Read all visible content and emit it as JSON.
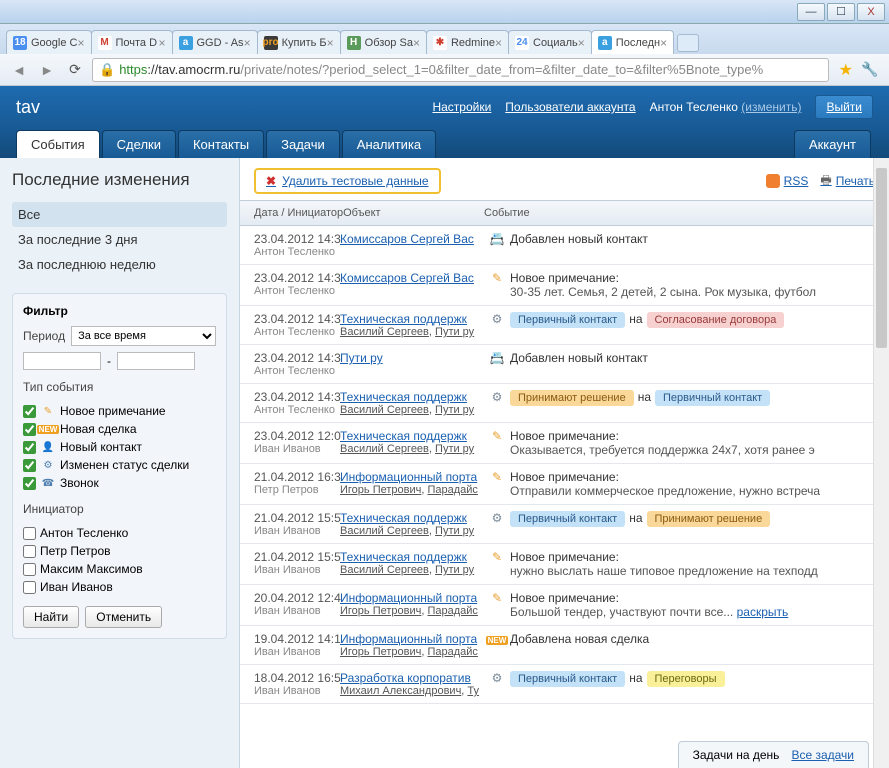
{
  "window": {
    "min": "—",
    "max": "☐",
    "close": "X"
  },
  "browserTabs": [
    {
      "favicon": "18",
      "faviconBg": "#4a8ef0",
      "faviconColor": "#fff",
      "label": "Google C"
    },
    {
      "favicon": "M",
      "faviconBg": "#fff",
      "faviconColor": "#d04030",
      "label": "Почта D"
    },
    {
      "favicon": "a",
      "faviconBg": "#3aa0e0",
      "faviconColor": "#fff",
      "label": "GGD - As"
    },
    {
      "favicon": "pro",
      "faviconBg": "#3a3a3a",
      "faviconColor": "#f0a020",
      "label": "Купить Б"
    },
    {
      "favicon": "H",
      "faviconBg": "#5a9a5a",
      "faviconColor": "#fff",
      "label": "Обзор Sa"
    },
    {
      "favicon": "✱",
      "faviconBg": "#fff",
      "faviconColor": "#d04030",
      "label": "Redmine"
    },
    {
      "favicon": "24",
      "faviconBg": "#fff",
      "faviconColor": "#4a8ef0",
      "label": "Социаль"
    },
    {
      "favicon": "a",
      "faviconBg": "#3aa0e0",
      "faviconColor": "#fff",
      "label": "Последн",
      "active": true
    }
  ],
  "url": {
    "https": "https",
    "domain": "://tav.amocrm.ru",
    "path": "/private/notes/?period_select_1=0&filter_date_from=&filter_date_to=&filter%5Bnote_type%"
  },
  "header": {
    "brand": "tav",
    "settings": "Настройки",
    "users": "Пользователи аккаунта",
    "user": "Антон Тесленко",
    "change": "(изменить)",
    "exit": "Выйти"
  },
  "nav": {
    "t1": "События",
    "t2": "Сделки",
    "t3": "Контакты",
    "t4": "Задачи",
    "t5": "Аналитика",
    "acct": "Аккаунт"
  },
  "sidebar": {
    "title": "Последние изменения",
    "all": "Все",
    "days3": "За последние 3 дня",
    "week": "За последнюю неделю",
    "filterTitle": "Фильтр",
    "periodLabel": "Период",
    "periodValue": "За все время",
    "dash": "-",
    "typeTitle": "Тип события",
    "c1": "Новое примечание",
    "c2": "Новая сделка",
    "c3": "Новый контакт",
    "c4": "Изменен статус сделки",
    "c5": "Звонок",
    "initiatorTitle": "Инициатор",
    "u1": "Антон Тесленко",
    "u2": "Петр Петров",
    "u3": "Максим Максимов",
    "u4": "Иван Иванов",
    "find": "Найти",
    "cancel": "Отменить"
  },
  "toolbar": {
    "delete": "Удалить тестовые данные",
    "rss": "RSS",
    "print": "Печать"
  },
  "gridHeader": {
    "c1": "Дата / ИнициаторОбъект",
    "c2": "Событие"
  },
  "events": [
    {
      "dt": "23.04.2012 14:3",
      "who": "Антон Тесленко",
      "obj": "Комиссаров Сергей Вас",
      "icon": "card",
      "body": "Добавлен новый контакт"
    },
    {
      "dt": "23.04.2012 14:3",
      "who": "Антон Тесленко",
      "obj": "Комиссаров Сергей Вас",
      "icon": "pencil",
      "title": "Новое примечание:",
      "body": "30-35 лет. Семья, 2 детей, 2 сына. Рок музыка, футбол"
    },
    {
      "dt": "23.04.2012 14:3",
      "who": "Антон Тесленко",
      "obj": "Техническая поддержк",
      "sub1": "Василий Сергеев",
      "sub2": "Пути ру",
      "icon": "gear",
      "pill1": "Первичный контакт",
      "pill1c": "blue",
      "between": "на",
      "pill2": "Согласование договора",
      "pill2c": "red"
    },
    {
      "dt": "23.04.2012 14:3",
      "who": "Антон Тесленко",
      "obj": "Пути ру",
      "icon": "card",
      "body": "Добавлен новый контакт"
    },
    {
      "dt": "23.04.2012 14:3",
      "who": "Антон Тесленко",
      "obj": "Техническая поддержк",
      "sub1": "Василий Сергеев",
      "sub2": "Пути ру",
      "icon": "gear",
      "pill1": "Принимают решение",
      "pill1c": "orange",
      "between": "на",
      "pill2": "Первичный контакт",
      "pill2c": "blue"
    },
    {
      "dt": "23.04.2012 12:0",
      "who": "Иван Иванов",
      "obj": "Техническая поддержк",
      "sub1": "Василий Сергеев",
      "sub2": "Пути ру",
      "icon": "pencil",
      "title": "Новое примечание:",
      "body": "Оказывается, требуется поддержка 24x7, хотя ранее э"
    },
    {
      "dt": "21.04.2012 16:3",
      "who": "Петр Петров",
      "obj": "Информационный порта",
      "sub1": "Игорь Петрович",
      "sub2": "Парадайс",
      "icon": "pencil",
      "title": "Новое примечание:",
      "body": "Отправили коммерческое предложение, нужно встреча"
    },
    {
      "dt": "21.04.2012 15:5",
      "who": "Иван Иванов",
      "obj": "Техническая поддержк",
      "sub1": "Василий Сергеев",
      "sub2": "Пути ру",
      "icon": "gear",
      "pill1": "Первичный контакт",
      "pill1c": "blue",
      "between": "на",
      "pill2": "Принимают решение",
      "pill2c": "orange"
    },
    {
      "dt": "21.04.2012 15:5",
      "who": "Иван Иванов",
      "obj": "Техническая поддержк",
      "sub1": "Василий Сергеев",
      "sub2": "Пути ру",
      "icon": "pencil",
      "title": "Новое примечание:",
      "body": "нужно выслать наше типовое предложение на техподд"
    },
    {
      "dt": "20.04.2012 12:4",
      "who": "Иван Иванов",
      "obj": "Информационный порта",
      "sub1": "Игорь Петрович",
      "sub2": "Парадайс",
      "icon": "pencil",
      "title": "Новое примечание:",
      "body": "Большой тендер, участвуют почти все...",
      "expand": "раскрыть"
    },
    {
      "dt": "19.04.2012 14:1",
      "who": "Иван Иванов",
      "obj": "Информационный порта",
      "sub1": "Игорь Петрович",
      "sub2": "Парадайс",
      "icon": "new",
      "body": "Добавлена новая сделка"
    },
    {
      "dt": "18.04.2012 16:5",
      "who": "Иван Иванов",
      "obj": "Разработка корпоратив",
      "sub1": "Михаил Александрович",
      "sub2": "Ту",
      "icon": "gear",
      "pill1": "Первичный контакт",
      "pill1c": "blue",
      "between": "на",
      "pill2": "Переговоры",
      "pill2c": "yellow"
    }
  ],
  "bottom": {
    "label": "Задачи на день",
    "link": "Все задачи"
  }
}
